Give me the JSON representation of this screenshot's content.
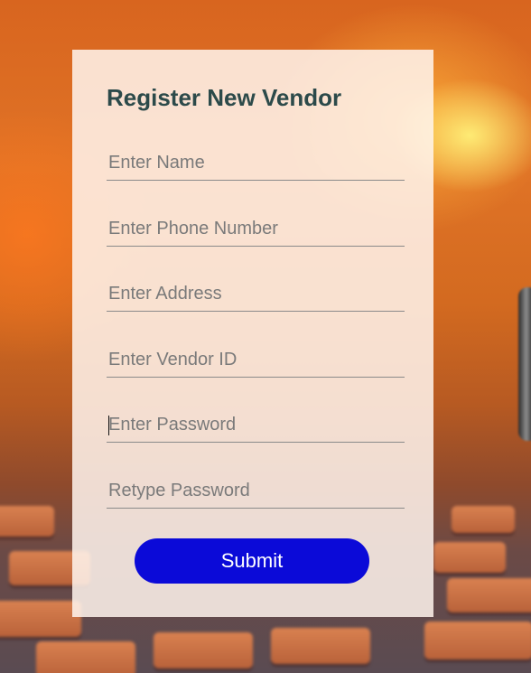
{
  "form": {
    "title": "Register New Vendor",
    "fields": [
      {
        "placeholder": "Enter Name",
        "value": ""
      },
      {
        "placeholder": "Enter Phone Number",
        "value": ""
      },
      {
        "placeholder": "Enter Address",
        "value": ""
      },
      {
        "placeholder": "Enter Vendor ID",
        "value": ""
      },
      {
        "placeholder": "Enter Password",
        "value": ""
      },
      {
        "placeholder": "Retype Password",
        "value": ""
      }
    ],
    "submit_label": "Submit"
  },
  "colors": {
    "title": "#2c4a4a",
    "submit_bg": "#0b0ad8",
    "submit_text": "#ffffff",
    "card_bg": "#fff5ee"
  }
}
